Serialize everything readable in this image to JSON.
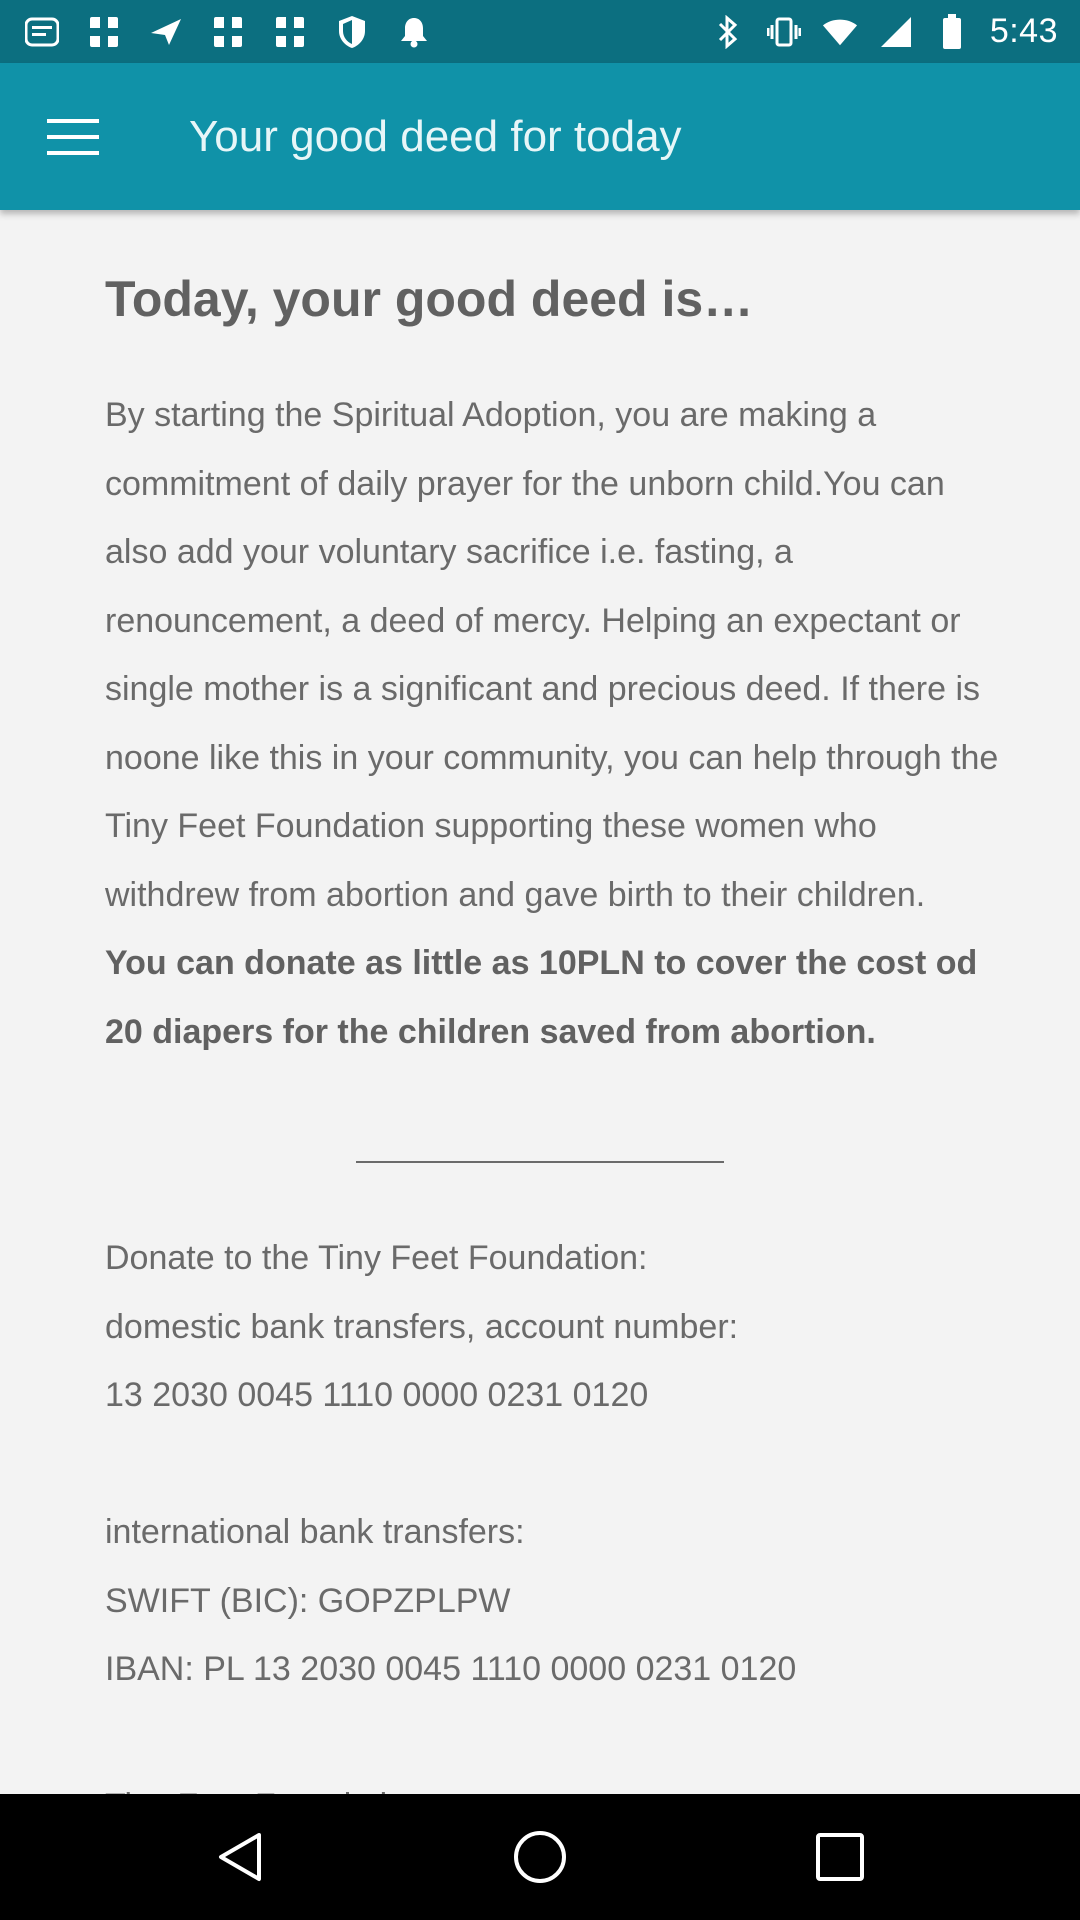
{
  "status_bar": {
    "time": "5:43",
    "left_icons": [
      "notification-icon",
      "image-icon",
      "signal-icon",
      "image-icon",
      "image-icon",
      "shield-icon",
      "bell-icon"
    ],
    "right_icons": [
      "bluetooth-icon",
      "vibrate-icon",
      "wifi-icon",
      "cell-signal-icon",
      "battery-icon"
    ]
  },
  "app_bar": {
    "title": "Your good deed for today",
    "color": "#1092a8"
  },
  "content": {
    "heading": "Today, your good deed is…",
    "paragraph": "By starting the Spiritual Adoption, you are making a commitment of daily prayer for the unborn child.You can also add your voluntary sacrifice i.e. fasting, a renouncement, a deed of mercy. Helping an expectant or single mother is a significant and precious deed. If there is noone like this in your community, you can help through the Tiny Feet Foundation supporting these women who withdrew from abortion and gave birth to their children.",
    "bold_paragraph": "You can donate as little as 10PLN to cover the cost od 20 diapers for the children saved from abortion.",
    "donate_title": "Donate to the Tiny Feet Foundation:",
    "domestic_label": "domestic bank transfers, account number:",
    "domestic_account": "13 2030 0045 1110 0000 0231 0120",
    "international_label": "international bank transfers:",
    "swift": "SWIFT (BIC): GOPZPLPW",
    "iban": "IBAN: PL 13 2030 0045 1110 0000 0231 0120",
    "foundation_name": "Tiny Feet Foundation"
  },
  "nav_bar": {
    "buttons": [
      "back-icon",
      "home-icon",
      "recents-icon"
    ]
  }
}
